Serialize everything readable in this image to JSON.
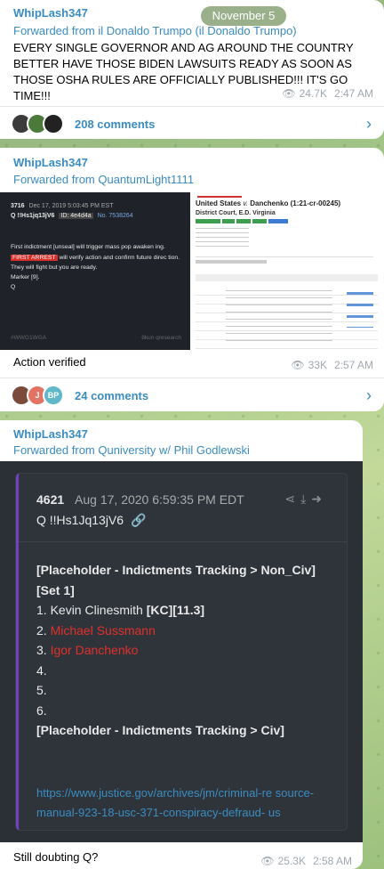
{
  "date_pill": "November 5",
  "post1": {
    "sender": "WhipLash347",
    "forwarded": "Forwarded from il Donaldo Trumpo (il Donaldo Trumpo)",
    "text": "EVERY SINGLE GOVERNOR AND AG AROUND THE COUNTRY BETTER HAVE THOSE BIDEN LAWSUITS READY AS SOON AS THOSE OSHA RULES ARE OFFICIALLY PUBLISHED!!! IT'S GO TIME!!!",
    "views": "24.7K",
    "time": "2:47 AM",
    "comments": "208 comments"
  },
  "post2": {
    "sender": "WhipLash347",
    "forwarded": "Forwarded from QuantumLight1111",
    "image": {
      "dark": {
        "header_num": "3716",
        "header_date": "Dec 17, 2019 5:03:45 PM EST",
        "trip": "Q !!Hs1jq13jV6",
        "id_label": "ID: 4e4d4a",
        "no_label": "No. 7538264",
        "line1": "First indictment [unseal] will trigger mass pop awaken ing.",
        "first_arrest": "FIRST ARREST",
        "line2": "will verify action and confirm future direc tion.",
        "line3": "They will fight but you are ready.",
        "line4": "Marker [9].",
        "line5": "Q",
        "tag": "#WWG1WGA",
        "footer": "8kun qresearch"
      },
      "light": {
        "title_prefix": "United States",
        "title_v": "v.",
        "title_rest": "Danchenko (1:21-cr-00245)",
        "court": "District Court, E.D. Virginia"
      }
    },
    "caption": "Action verified",
    "views": "33K",
    "time": "2:57 AM",
    "comments": "24 comments"
  },
  "post3": {
    "sender": "WhipLash347",
    "forwarded": "Forwarded from Quniversity w/ Phil Godlewski",
    "card": {
      "num": "4621",
      "date": "Aug 17, 2020 6:59:35 PM EDT",
      "trip": "Q !!Hs1Jq13jV6",
      "heading": "[Placeholder - Indictments Tracking > Non_Civ]",
      "set": "[Set 1]",
      "items": [
        "1. Kevin Clinesmith ",
        "[KC][11.3]",
        "2. ",
        "Michael Sussmann",
        "3. ",
        "Igor Danchenko",
        "4.",
        "5.",
        "6."
      ],
      "heading2": "[Placeholder - Indictments Tracking > Civ]",
      "link": "https://www.justice.gov/archives/jm/criminal-re source-manual-923-18-usc-371-conspiracy-defraud- us"
    },
    "caption": "Still doubting Q?",
    "views": "25.3K",
    "time": "2:58 AM"
  },
  "colors": {
    "link_blue": "#3a8cc1",
    "red": "#e0302a",
    "q_accent": "#6f42c1"
  }
}
